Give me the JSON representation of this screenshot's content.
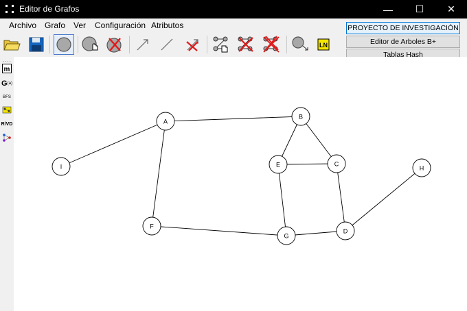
{
  "window": {
    "title": "Editor de Grafos",
    "minimize_symbol": "—",
    "maximize_symbol": "☐",
    "close_symbol": "✕"
  },
  "menu": [
    "Archivo",
    "Grafo",
    "Ver",
    "Configuración",
    "Atributos"
  ],
  "toolbar": {
    "tools": [
      "open-folder-icon",
      "save-icon",
      "add-node-icon",
      "move-node-icon",
      "delete-node-icon",
      "directed-edge-icon",
      "undirected-edge-icon",
      "delete-edge-icon",
      "move-graph-icon",
      "delete-graph-icon",
      "clear-all-icon",
      "node-arrow-icon",
      "rename-icon"
    ],
    "rename_label": "LN"
  },
  "right_panel": {
    "project_button": "PROYECTO DE INVESTIGACIÓN",
    "bplus_button": "Editor de Arboles B+",
    "hash_button": "Tablas Hash"
  },
  "sidebar": {
    "dots": "....",
    "items": [
      "m",
      "G",
      "BFS",
      "DFS",
      "R/VD",
      "graph"
    ],
    "g_label": "G",
    "g_sub": "(a)",
    "bfs_label": "BFS",
    "rvd_label": "R/VD"
  },
  "graph": {
    "nodes": [
      {
        "id": "A",
        "label": "A"
      },
      {
        "id": "B",
        "label": "B"
      },
      {
        "id": "C",
        "label": "C"
      },
      {
        "id": "D",
        "label": "D"
      },
      {
        "id": "E",
        "label": "E"
      },
      {
        "id": "F",
        "label": "F"
      },
      {
        "id": "G",
        "label": "G"
      },
      {
        "id": "H",
        "label": "H"
      },
      {
        "id": "I",
        "label": "I"
      }
    ],
    "edges": [
      [
        "A",
        "B"
      ],
      [
        "A",
        "I"
      ],
      [
        "A",
        "F"
      ],
      [
        "B",
        "E"
      ],
      [
        "B",
        "C"
      ],
      [
        "E",
        "C"
      ],
      [
        "E",
        "G"
      ],
      [
        "C",
        "D"
      ],
      [
        "F",
        "G"
      ],
      [
        "G",
        "D"
      ],
      [
        "D",
        "H"
      ]
    ]
  }
}
